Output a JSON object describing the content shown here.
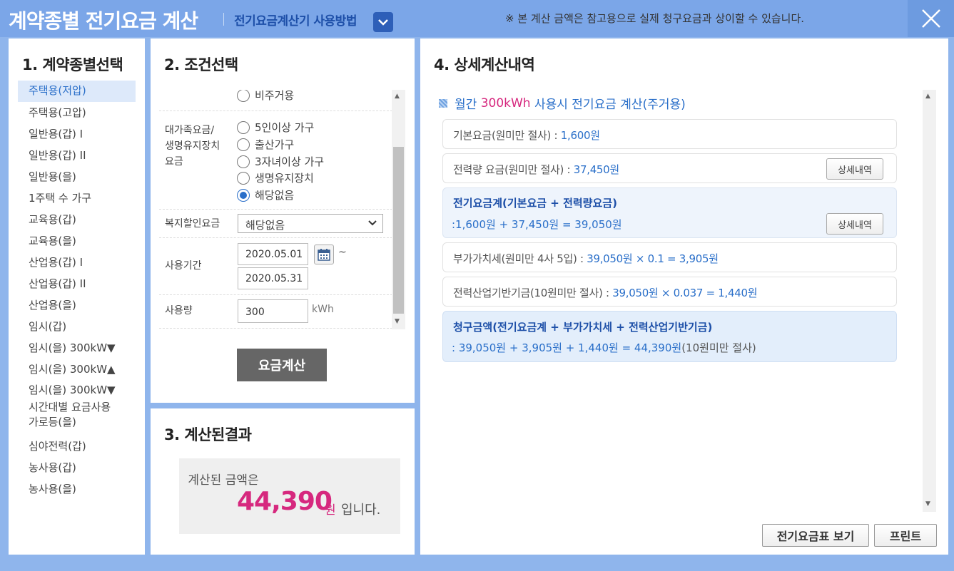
{
  "header": {
    "title": "계약종별 전기요금 계산",
    "guide_link": "전기요금계산기 사용방법",
    "notice": "※ 본 계산 금액은 참고용으로 실제 청구요금과 상이할 수 있습니다."
  },
  "panel1": {
    "title": "1. 계약종별선택",
    "items": [
      "주택용(저압)",
      "주택용(고압)",
      "일반용(갑) I",
      "일반용(갑) II",
      "일반용(을)",
      "1주택 수 가구",
      "교육용(갑)",
      "교육용(을)",
      "산업용(갑) I",
      "산업용(갑) II",
      "산업용(을)",
      "임시(갑)",
      "임시(을) 300kW▼",
      "임시(을) 300kW▲",
      "임시(을) 300kW▼\n시간대별 요금사용",
      "가로등(을)",
      "심야전력(갑)",
      "농사용(갑)",
      "농사용(을)"
    ]
  },
  "panel2": {
    "title": "2. 조건선택",
    "residence_option": "비주거용",
    "family_label": "대가족요금/\n생명유지장치\n요금",
    "family_options": [
      "5인이상 가구",
      "출산가구",
      "3자녀이상 가구",
      "생명유지장치",
      "해당없음"
    ],
    "welfare_label": "복지할인요금",
    "welfare_value": "해당없음",
    "period_label": "사용기간",
    "period_start": "2020.05.01",
    "period_end": "2020.05.31",
    "period_sep": "~",
    "usage_label": "사용량",
    "usage_value": "300",
    "usage_unit": "kWh",
    "calc_button": "요금계산"
  },
  "panel3": {
    "title": "3. 계산된결과",
    "label": "계산된 금액은",
    "amount": "44,390",
    "unit": "원",
    "suffix": "입니다."
  },
  "panel4": {
    "title": "4. 상세계산내역",
    "heading_pre": "월간 ",
    "heading_usage": "300kWh",
    "heading_post": " 사용시 전기요금 계산(주거용)",
    "base_fee_label": "기본요금(원미만 절사) : ",
    "base_fee_value": "1,600원",
    "energy_fee_label": "전력량 요금(원미만 절사) : ",
    "energy_fee_value": "37,450원",
    "detail_button": "상세내역",
    "subtotal_title": "전기요금계(기본요금 + 전력량요금)",
    "subtotal_formula": ":1,600원 + 37,450원 = 39,050원",
    "vat_label": "부가가치세(원미만 4사 5입) : ",
    "vat_formula": "39,050원 × 0.1 = 3,905원",
    "fund_label": "전력산업기반기금(10원미만 절사) : ",
    "fund_formula": "39,050원 × 0.037 = 1,440원",
    "total_title": "청구금액(전기요금계 + 부가가치세 + 전력산업기반기금)",
    "total_formula": ": 39,050원 + 3,905원 + 1,440원 = 44,390원",
    "total_note": "(10원미만 절사)",
    "rate_table_button": "전기요금표 보기",
    "print_button": "프린트"
  },
  "colors": {
    "header_bg": "#7ba6e8",
    "accent_blue": "#2a6fc9",
    "amount_pink": "#d6287e"
  }
}
